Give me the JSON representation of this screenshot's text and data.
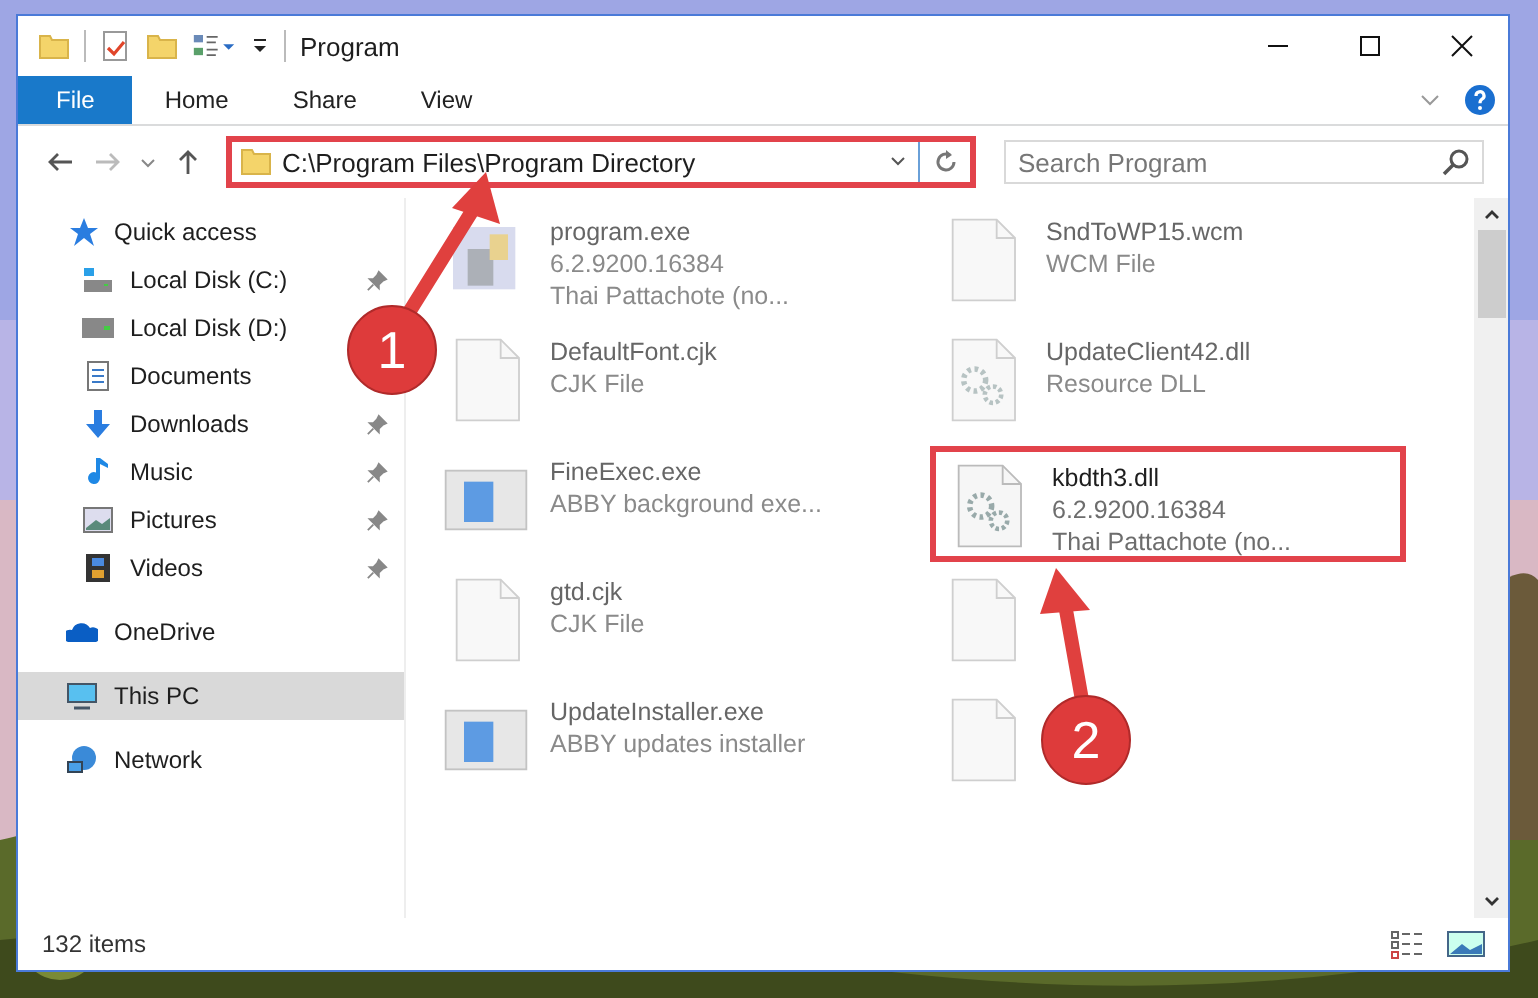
{
  "window": {
    "title": "Program"
  },
  "ribbon": {
    "tabs": [
      {
        "label": "File",
        "kind": "file-menu"
      },
      {
        "label": "Home",
        "kind": "tab"
      },
      {
        "label": "Share",
        "kind": "tab"
      },
      {
        "label": "View",
        "kind": "tab"
      }
    ]
  },
  "address_bar": {
    "path": "C:\\Program Files\\Program Directory",
    "highlighted": true
  },
  "search": {
    "placeholder": "Search Program"
  },
  "sidebar": {
    "items": [
      {
        "label": "Quick access",
        "kind": "star",
        "pinned": false,
        "selected": false,
        "group": true
      },
      {
        "label": "Local Disk (C:)",
        "kind": "drive-c",
        "pinned": true,
        "selected": false,
        "group": false
      },
      {
        "label": "Local Disk (D:)",
        "kind": "drive",
        "pinned": false,
        "selected": false,
        "group": false
      },
      {
        "label": "Documents",
        "kind": "documents",
        "pinned": false,
        "selected": false,
        "group": false
      },
      {
        "label": "Downloads",
        "kind": "downloads",
        "pinned": true,
        "selected": false,
        "group": false
      },
      {
        "label": "Music",
        "kind": "music",
        "pinned": true,
        "selected": false,
        "group": false
      },
      {
        "label": "Pictures",
        "kind": "pictures",
        "pinned": true,
        "selected": false,
        "group": false
      },
      {
        "label": "Videos",
        "kind": "videos",
        "pinned": true,
        "selected": false,
        "group": false
      },
      {
        "label": "OneDrive",
        "kind": "cloud",
        "pinned": false,
        "selected": false,
        "group": true
      },
      {
        "label": "This PC",
        "kind": "pc",
        "pinned": false,
        "selected": true,
        "group": true
      },
      {
        "label": "Network",
        "kind": "network",
        "pinned": false,
        "selected": false,
        "group": true
      }
    ]
  },
  "files": [
    {
      "name": "program.exe",
      "lines": [
        "6.2.9200.16384",
        "Thai Pattachote (no..."
      ],
      "kind": "app",
      "highlighted": false
    },
    {
      "name": "SndToWP15.wcm",
      "lines": [
        "WCM File"
      ],
      "kind": "blank",
      "highlighted": false
    },
    {
      "name": "DefaultFont.cjk",
      "lines": [
        "CJK File"
      ],
      "kind": "blank",
      "highlighted": false
    },
    {
      "name": "UpdateClient42.dll",
      "lines": [
        "Resource DLL"
      ],
      "kind": "gears",
      "highlighted": false
    },
    {
      "name": "FineExec.exe",
      "lines": [
        "ABBY background exe..."
      ],
      "kind": "window",
      "highlighted": false
    },
    {
      "name": "kbdth3.dll",
      "lines": [
        "6.2.9200.16384",
        "Thai Pattachote (no..."
      ],
      "kind": "gears",
      "highlighted": true
    },
    {
      "name": "gtd.cjk",
      "lines": [
        "CJK File"
      ],
      "kind": "blank",
      "highlighted": false
    },
    {
      "kind": "blank",
      "highlighted": false
    },
    {
      "name": "UpdateInstaller.exe",
      "lines": [
        "ABBY updates installer"
      ],
      "kind": "window",
      "highlighted": false
    },
    {
      "kind": "blank",
      "highlighted": false
    }
  ],
  "callouts": [
    {
      "number": "1"
    },
    {
      "number": "2"
    }
  ],
  "status_bar": {
    "item_count": "132 items"
  }
}
